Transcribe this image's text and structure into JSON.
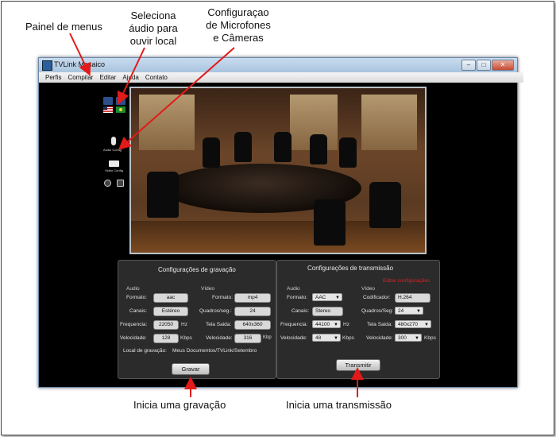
{
  "callouts": {
    "painel": "Painel de menus",
    "seleciona": [
      "Seleciona",
      "áudio para",
      "ouvir local"
    ],
    "config": [
      "Configuraçao",
      "de Microfones",
      "e Câmeras"
    ],
    "grav": "Inicia uma gravação",
    "trans": "Inicia uma transmissão"
  },
  "window": {
    "title": "TVLink Mosaico",
    "menu": [
      "Perfis",
      "Compilar",
      "Editar",
      "Ajuda",
      "Contato"
    ],
    "controls": [
      "–",
      "□",
      "✕"
    ]
  },
  "tools": {
    "audio_label": "Audio Config",
    "video_label": "Video Config",
    "icons": [
      "speaker-icon",
      "us-flag-icon",
      "brazil-flag-icon",
      "microphone-icon",
      "camera-icon",
      "settings-icon",
      "search-icon"
    ]
  },
  "record": {
    "title": "Configurações de gravação",
    "audio_header": "Audio",
    "video_header": "Vídeo",
    "audio": [
      {
        "label": "Formato:",
        "value": "aac"
      },
      {
        "label": "Canais:",
        "value": "Estéreo"
      },
      {
        "label": "Frequencia:",
        "value": "22050",
        "unit": "Hz"
      },
      {
        "label": "Velocidade:",
        "value": "128",
        "unit": "Kbps"
      }
    ],
    "video": [
      {
        "label": "Formato:",
        "value": "mp4"
      },
      {
        "label": "Quadros/seg.:",
        "value": "24"
      },
      {
        "label": "Tela Saida:",
        "value": "640x360"
      },
      {
        "label": "Velocidade:",
        "value": "316",
        "unit": "Kbp"
      }
    ],
    "location_label": "Local de gravação:",
    "location_value": "Meus Documentos/TVLink/Setembro",
    "button": "Gravar"
  },
  "transmit": {
    "title": "Configurações de transmissão",
    "edit_link": "Editar configurações",
    "audio_header": "Audio",
    "video_header": "Vídeo",
    "audio": [
      {
        "label": "Formato:",
        "value": "AAC"
      },
      {
        "label": "Canais:",
        "value": "Stereo"
      },
      {
        "label": "Frequencia:",
        "value": "44100",
        "unit": "Hz"
      },
      {
        "label": "Velocidade:",
        "value": "48",
        "unit": "Kbps"
      }
    ],
    "video": [
      {
        "label": "Codificador:",
        "value": "H.264"
      },
      {
        "label": "Quadros/Seg:",
        "value": "24"
      },
      {
        "label": "Tela Saida:",
        "value": "480x270"
      },
      {
        "label": "Velocidade:",
        "value": "300",
        "unit": "Kbps"
      }
    ],
    "button": "Transmitir"
  },
  "colors": {
    "accent_red": "#e02020",
    "panel_bg": "#2b2b2b",
    "titlebar": "#b9d1ea"
  }
}
